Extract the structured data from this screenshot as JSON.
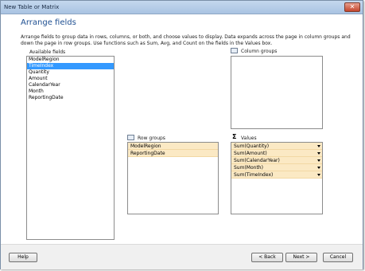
{
  "window": {
    "title": "New Table or Matrix",
    "close_glyph": "✕"
  },
  "heading": "Arrange fields",
  "description": "Arrange fields to group data in rows, columns, or both, and choose values to display. Data expands across the page in column groups and down the page in row groups.  Use functions such as Sum, Avg, and Count on the fields in the Values box.",
  "available_fields": {
    "label": "Available fields",
    "items": [
      "ModelRegion",
      "TimeIndex",
      "Quantity",
      "Amount",
      "CalendarYear",
      "Month",
      "ReportingDate"
    ],
    "selected_index": 1
  },
  "column_groups": {
    "label": "Column groups",
    "items": []
  },
  "row_groups": {
    "label": "Row groups",
    "items": [
      "ModelRegion",
      "ReportingDate"
    ]
  },
  "values": {
    "label": "Values",
    "icon_glyph": "Σ",
    "items": [
      "Sum(Quantity)",
      "Sum(Amount)",
      "Sum(CalendarYear)",
      "Sum(Month)",
      "Sum(TimeIndex)"
    ]
  },
  "buttons": {
    "help": "Help",
    "back": "< Back",
    "next": "Next >",
    "cancel": "Cancel"
  },
  "colors": {
    "accent": "#1e4f91",
    "selection": "#3399ff",
    "zone_item": "#fbe9c4"
  }
}
